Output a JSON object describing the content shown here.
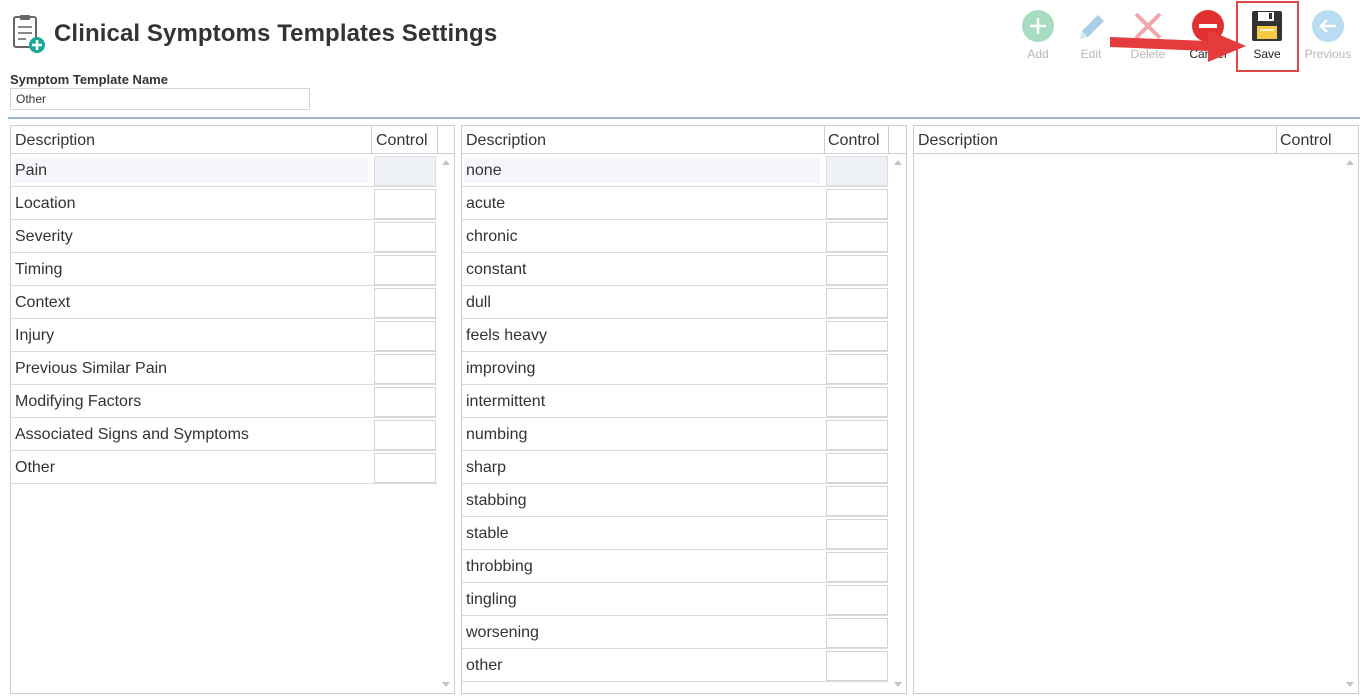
{
  "header": {
    "title": "Clinical Symptoms Templates Settings",
    "name_label": "Symptom Template Name",
    "name_value": "Other"
  },
  "toolbar": {
    "add": "Add",
    "edit": "Edit",
    "delete": "Delete",
    "cancel": "Cancel",
    "save": "Save",
    "previous": "Previous"
  },
  "colors": {
    "add_icon": "#a8dcc0",
    "edit_icon": "#a9cfe8",
    "delete_icon": "#f3a6a6",
    "cancel_icon": "#e0302f",
    "previous_icon": "#b9dcf0",
    "highlight": "#e04848"
  },
  "grids": [
    {
      "header": {
        "description": "Description",
        "control": "Control"
      },
      "rows": [
        "Pain",
        "Location",
        "Severity",
        "Timing",
        "Context",
        "Injury",
        "Previous Similar Pain",
        "Modifying Factors",
        "Associated Signs and Symptoms",
        "Other"
      ]
    },
    {
      "header": {
        "description": "Description",
        "control": "Control"
      },
      "rows": [
        "none",
        "acute",
        "chronic",
        "constant",
        "dull",
        "feels heavy",
        "improving",
        "intermittent",
        "numbing",
        "sharp",
        "stabbing",
        "stable",
        "throbbing",
        "tingling",
        "worsening",
        "other"
      ]
    },
    {
      "header": {
        "description": "Description",
        "control": "Control"
      },
      "rows": []
    }
  ]
}
